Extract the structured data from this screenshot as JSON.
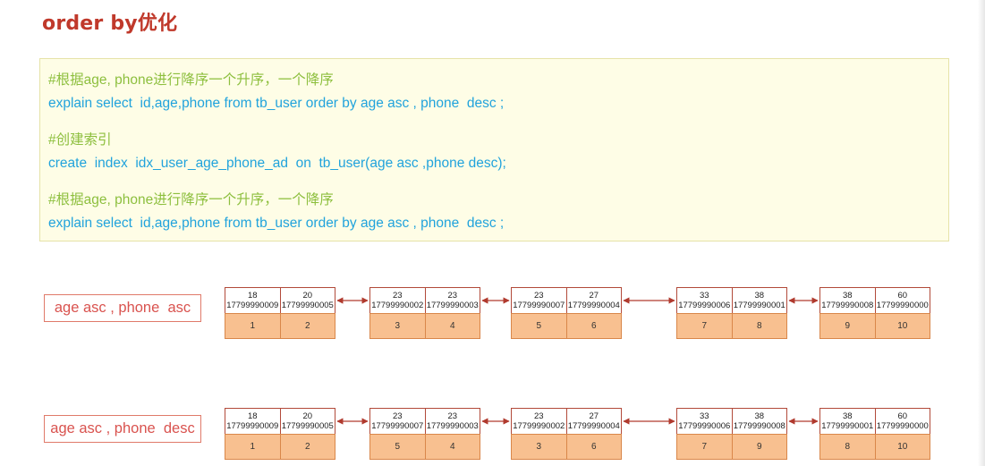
{
  "title": "order by优化",
  "code_lines": [
    {
      "type": "comment",
      "text": "#根据age, phone进行降序一个升序，一个降序"
    },
    {
      "type": "sql",
      "text": "explain select  id,age,phone from tb_user order by age asc , phone  desc ;"
    },
    {
      "type": "comment",
      "text": "#创建索引"
    },
    {
      "type": "sql",
      "text": "create  index  idx_user_age_phone_ad  on  tb_user(age asc ,phone desc);"
    },
    {
      "type": "comment",
      "text": "#根据age, phone进行降序一个升序，一个降序"
    },
    {
      "type": "sql",
      "text": "explain select  id,age,phone from tb_user order by age asc , phone  desc ;"
    }
  ],
  "rows": [
    {
      "label": "age asc , phone  asc",
      "nodes": [
        {
          "entries": [
            {
              "age": "18",
              "phone": "17799990009",
              "id": "1"
            },
            {
              "age": "20",
              "phone": "17799990005",
              "id": "2"
            }
          ]
        },
        {
          "entries": [
            {
              "age": "23",
              "phone": "17799990002",
              "id": "3"
            },
            {
              "age": "23",
              "phone": "17799990003",
              "id": "4"
            }
          ]
        },
        {
          "entries": [
            {
              "age": "23",
              "phone": "17799990007",
              "id": "5"
            },
            {
              "age": "27",
              "phone": "17799990004",
              "id": "6"
            }
          ]
        },
        {
          "entries": [
            {
              "age": "33",
              "phone": "17799990006",
              "id": "7"
            },
            {
              "age": "38",
              "phone": "17799990001",
              "id": "8"
            }
          ]
        },
        {
          "entries": [
            {
              "age": "38",
              "phone": "17799990008",
              "id": "9"
            },
            {
              "age": "60",
              "phone": "17799990000",
              "id": "10"
            }
          ]
        }
      ]
    },
    {
      "label": "age asc , phone  desc",
      "nodes": [
        {
          "entries": [
            {
              "age": "18",
              "phone": "17799990009",
              "id": "1"
            },
            {
              "age": "20",
              "phone": "17799990005",
              "id": "2"
            }
          ]
        },
        {
          "entries": [
            {
              "age": "23",
              "phone": "17799990007",
              "id": "5"
            },
            {
              "age": "23",
              "phone": "17799990003",
              "id": "4"
            }
          ]
        },
        {
          "entries": [
            {
              "age": "23",
              "phone": "17799990002",
              "id": "3"
            },
            {
              "age": "27",
              "phone": "17799990004",
              "id": "6"
            }
          ]
        },
        {
          "entries": [
            {
              "age": "33",
              "phone": "17799990006",
              "id": "7"
            },
            {
              "age": "38",
              "phone": "17799990008",
              "id": "9"
            }
          ]
        },
        {
          "entries": [
            {
              "age": "38",
              "phone": "17799990001",
              "id": "8"
            },
            {
              "age": "60",
              "phone": "17799990000",
              "id": "10"
            }
          ]
        }
      ]
    }
  ],
  "colors": {
    "title": "#c0392b",
    "comment": "#8dbf3e",
    "sql": "#21a3dc",
    "panel_bg": "#fefde6",
    "key_border": "#b24a3a",
    "id_fill": "#f8c090",
    "link": "#b03a2e"
  }
}
